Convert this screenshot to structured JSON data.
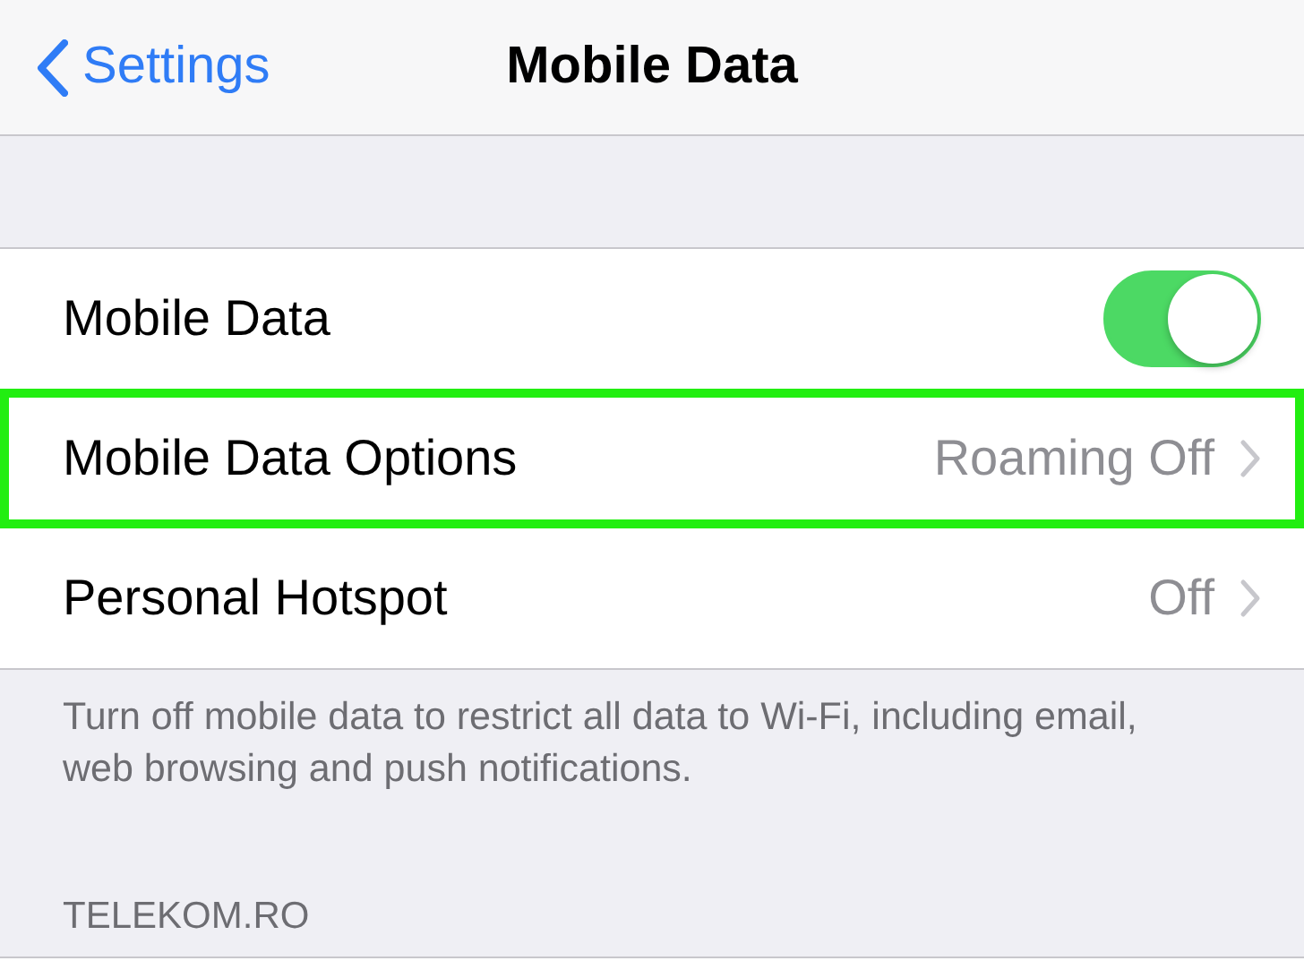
{
  "nav": {
    "back": "Settings",
    "title": "Mobile Data"
  },
  "rows": [
    {
      "kind": "toggle",
      "label": "Mobile Data",
      "on": true,
      "highlighted": false
    },
    {
      "kind": "link",
      "label": "Mobile Data Options",
      "value": "Roaming Off",
      "highlighted": true
    },
    {
      "kind": "link",
      "label": "Personal Hotspot",
      "value": "Off",
      "highlighted": false
    }
  ],
  "footer": "Turn off mobile data to restrict all data to Wi-Fi, including email, web browsing and push notifications.",
  "section_header": "TELEKOM.RO"
}
